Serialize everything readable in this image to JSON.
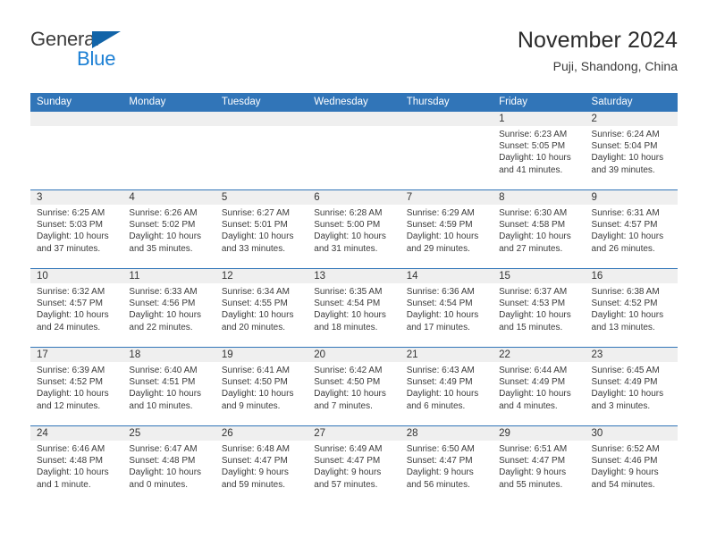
{
  "brand": {
    "name_part1": "General",
    "name_part2": "Blue",
    "triangle_color": "#1264a8",
    "blue_color": "#1b7fd4"
  },
  "header": {
    "title": "November 2024",
    "subtitle": "Puji, Shandong, China"
  },
  "theme": {
    "accent": "#3175b8",
    "date_band": "#efefef",
    "text": "#3b3b3b"
  },
  "weekdays": [
    "Sunday",
    "Monday",
    "Tuesday",
    "Wednesday",
    "Thursday",
    "Friday",
    "Saturday"
  ],
  "weeks": [
    [
      {
        "day": "",
        "empty": true,
        "sunrise": "",
        "sunset": "",
        "daylight1": "",
        "daylight2": ""
      },
      {
        "day": "",
        "empty": true,
        "sunrise": "",
        "sunset": "",
        "daylight1": "",
        "daylight2": ""
      },
      {
        "day": "",
        "empty": true,
        "sunrise": "",
        "sunset": "",
        "daylight1": "",
        "daylight2": ""
      },
      {
        "day": "",
        "empty": true,
        "sunrise": "",
        "sunset": "",
        "daylight1": "",
        "daylight2": ""
      },
      {
        "day": "",
        "empty": true,
        "sunrise": "",
        "sunset": "",
        "daylight1": "",
        "daylight2": ""
      },
      {
        "day": "1",
        "empty": false,
        "sunrise": "Sunrise: 6:23 AM",
        "sunset": "Sunset: 5:05 PM",
        "daylight1": "Daylight: 10 hours",
        "daylight2": "and 41 minutes."
      },
      {
        "day": "2",
        "empty": false,
        "sunrise": "Sunrise: 6:24 AM",
        "sunset": "Sunset: 5:04 PM",
        "daylight1": "Daylight: 10 hours",
        "daylight2": "and 39 minutes."
      }
    ],
    [
      {
        "day": "3",
        "empty": false,
        "sunrise": "Sunrise: 6:25 AM",
        "sunset": "Sunset: 5:03 PM",
        "daylight1": "Daylight: 10 hours",
        "daylight2": "and 37 minutes."
      },
      {
        "day": "4",
        "empty": false,
        "sunrise": "Sunrise: 6:26 AM",
        "sunset": "Sunset: 5:02 PM",
        "daylight1": "Daylight: 10 hours",
        "daylight2": "and 35 minutes."
      },
      {
        "day": "5",
        "empty": false,
        "sunrise": "Sunrise: 6:27 AM",
        "sunset": "Sunset: 5:01 PM",
        "daylight1": "Daylight: 10 hours",
        "daylight2": "and 33 minutes."
      },
      {
        "day": "6",
        "empty": false,
        "sunrise": "Sunrise: 6:28 AM",
        "sunset": "Sunset: 5:00 PM",
        "daylight1": "Daylight: 10 hours",
        "daylight2": "and 31 minutes."
      },
      {
        "day": "7",
        "empty": false,
        "sunrise": "Sunrise: 6:29 AM",
        "sunset": "Sunset: 4:59 PM",
        "daylight1": "Daylight: 10 hours",
        "daylight2": "and 29 minutes."
      },
      {
        "day": "8",
        "empty": false,
        "sunrise": "Sunrise: 6:30 AM",
        "sunset": "Sunset: 4:58 PM",
        "daylight1": "Daylight: 10 hours",
        "daylight2": "and 27 minutes."
      },
      {
        "day": "9",
        "empty": false,
        "sunrise": "Sunrise: 6:31 AM",
        "sunset": "Sunset: 4:57 PM",
        "daylight1": "Daylight: 10 hours",
        "daylight2": "and 26 minutes."
      }
    ],
    [
      {
        "day": "10",
        "empty": false,
        "sunrise": "Sunrise: 6:32 AM",
        "sunset": "Sunset: 4:57 PM",
        "daylight1": "Daylight: 10 hours",
        "daylight2": "and 24 minutes."
      },
      {
        "day": "11",
        "empty": false,
        "sunrise": "Sunrise: 6:33 AM",
        "sunset": "Sunset: 4:56 PM",
        "daylight1": "Daylight: 10 hours",
        "daylight2": "and 22 minutes."
      },
      {
        "day": "12",
        "empty": false,
        "sunrise": "Sunrise: 6:34 AM",
        "sunset": "Sunset: 4:55 PM",
        "daylight1": "Daylight: 10 hours",
        "daylight2": "and 20 minutes."
      },
      {
        "day": "13",
        "empty": false,
        "sunrise": "Sunrise: 6:35 AM",
        "sunset": "Sunset: 4:54 PM",
        "daylight1": "Daylight: 10 hours",
        "daylight2": "and 18 minutes."
      },
      {
        "day": "14",
        "empty": false,
        "sunrise": "Sunrise: 6:36 AM",
        "sunset": "Sunset: 4:54 PM",
        "daylight1": "Daylight: 10 hours",
        "daylight2": "and 17 minutes."
      },
      {
        "day": "15",
        "empty": false,
        "sunrise": "Sunrise: 6:37 AM",
        "sunset": "Sunset: 4:53 PM",
        "daylight1": "Daylight: 10 hours",
        "daylight2": "and 15 minutes."
      },
      {
        "day": "16",
        "empty": false,
        "sunrise": "Sunrise: 6:38 AM",
        "sunset": "Sunset: 4:52 PM",
        "daylight1": "Daylight: 10 hours",
        "daylight2": "and 13 minutes."
      }
    ],
    [
      {
        "day": "17",
        "empty": false,
        "sunrise": "Sunrise: 6:39 AM",
        "sunset": "Sunset: 4:52 PM",
        "daylight1": "Daylight: 10 hours",
        "daylight2": "and 12 minutes."
      },
      {
        "day": "18",
        "empty": false,
        "sunrise": "Sunrise: 6:40 AM",
        "sunset": "Sunset: 4:51 PM",
        "daylight1": "Daylight: 10 hours",
        "daylight2": "and 10 minutes."
      },
      {
        "day": "19",
        "empty": false,
        "sunrise": "Sunrise: 6:41 AM",
        "sunset": "Sunset: 4:50 PM",
        "daylight1": "Daylight: 10 hours",
        "daylight2": "and 9 minutes."
      },
      {
        "day": "20",
        "empty": false,
        "sunrise": "Sunrise: 6:42 AM",
        "sunset": "Sunset: 4:50 PM",
        "daylight1": "Daylight: 10 hours",
        "daylight2": "and 7 minutes."
      },
      {
        "day": "21",
        "empty": false,
        "sunrise": "Sunrise: 6:43 AM",
        "sunset": "Sunset: 4:49 PM",
        "daylight1": "Daylight: 10 hours",
        "daylight2": "and 6 minutes."
      },
      {
        "day": "22",
        "empty": false,
        "sunrise": "Sunrise: 6:44 AM",
        "sunset": "Sunset: 4:49 PM",
        "daylight1": "Daylight: 10 hours",
        "daylight2": "and 4 minutes."
      },
      {
        "day": "23",
        "empty": false,
        "sunrise": "Sunrise: 6:45 AM",
        "sunset": "Sunset: 4:49 PM",
        "daylight1": "Daylight: 10 hours",
        "daylight2": "and 3 minutes."
      }
    ],
    [
      {
        "day": "24",
        "empty": false,
        "sunrise": "Sunrise: 6:46 AM",
        "sunset": "Sunset: 4:48 PM",
        "daylight1": "Daylight: 10 hours",
        "daylight2": "and 1 minute."
      },
      {
        "day": "25",
        "empty": false,
        "sunrise": "Sunrise: 6:47 AM",
        "sunset": "Sunset: 4:48 PM",
        "daylight1": "Daylight: 10 hours",
        "daylight2": "and 0 minutes."
      },
      {
        "day": "26",
        "empty": false,
        "sunrise": "Sunrise: 6:48 AM",
        "sunset": "Sunset: 4:47 PM",
        "daylight1": "Daylight: 9 hours",
        "daylight2": "and 59 minutes."
      },
      {
        "day": "27",
        "empty": false,
        "sunrise": "Sunrise: 6:49 AM",
        "sunset": "Sunset: 4:47 PM",
        "daylight1": "Daylight: 9 hours",
        "daylight2": "and 57 minutes."
      },
      {
        "day": "28",
        "empty": false,
        "sunrise": "Sunrise: 6:50 AM",
        "sunset": "Sunset: 4:47 PM",
        "daylight1": "Daylight: 9 hours",
        "daylight2": "and 56 minutes."
      },
      {
        "day": "29",
        "empty": false,
        "sunrise": "Sunrise: 6:51 AM",
        "sunset": "Sunset: 4:47 PM",
        "daylight1": "Daylight: 9 hours",
        "daylight2": "and 55 minutes."
      },
      {
        "day": "30",
        "empty": false,
        "sunrise": "Sunrise: 6:52 AM",
        "sunset": "Sunset: 4:46 PM",
        "daylight1": "Daylight: 9 hours",
        "daylight2": "and 54 minutes."
      }
    ]
  ]
}
